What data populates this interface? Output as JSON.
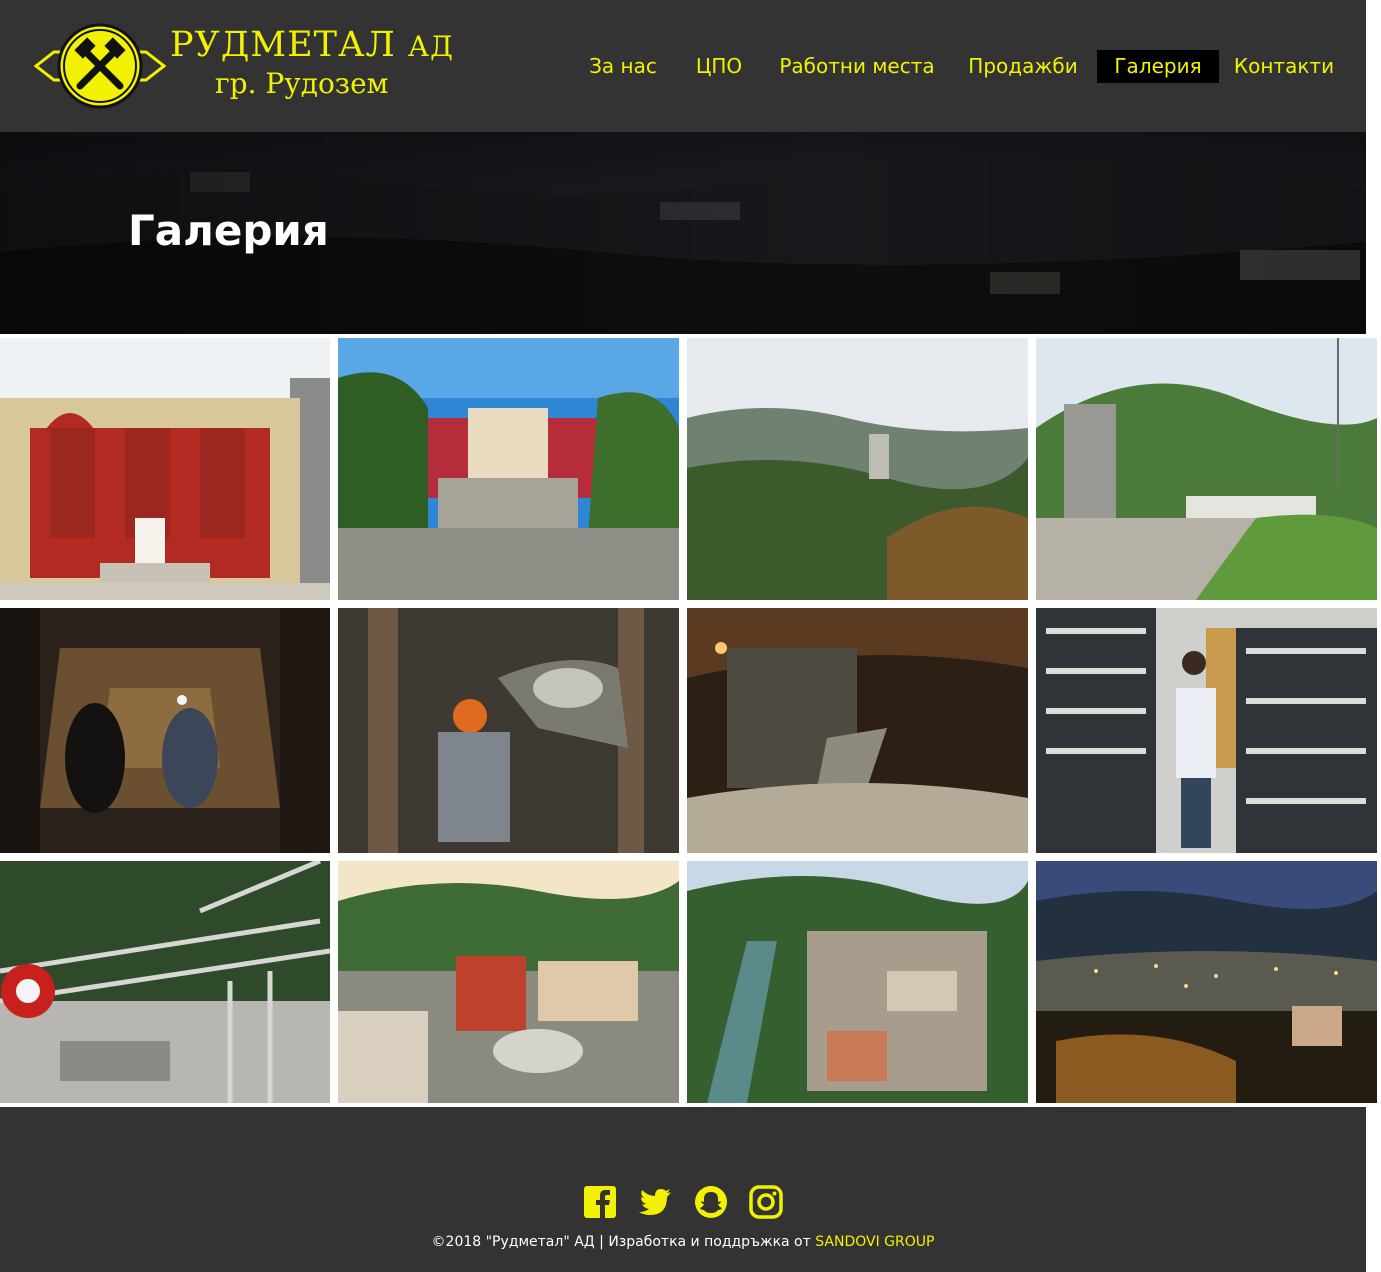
{
  "brand": {
    "name": "РУДМЕТАЛ",
    "suffix": "АД",
    "city": "гр. Рудозем"
  },
  "nav": {
    "items": [
      "За нас",
      "ЦПО",
      "Работни места",
      "Продажби",
      "Галерия",
      "Контакти"
    ],
    "active": "Галерия"
  },
  "hero": {
    "title": "Галерия"
  },
  "gallery": {
    "images": [
      "administration-building-front",
      "administration-building-courtyard",
      "mine-shaft-tower-mountains",
      "mine-shaft-tower-hill",
      "miners-underground",
      "miner-drilling",
      "mine-loader-underground",
      "lamp-room-worker",
      "mine-hoist-machinery",
      "rudozem-aerial-square",
      "rudozem-aerial-river",
      "rudozem-night"
    ]
  },
  "footer": {
    "social": [
      "facebook-icon",
      "twitter-icon",
      "snapchat-icon",
      "instagram-icon"
    ],
    "copyright": "©2018 \"Рудметал\" АД | Изработка и поддръжка от",
    "credit": "SANDOVI GROUP"
  },
  "colors": {
    "accent": "#f2f200",
    "header_bg": "#333333",
    "active_nav_bg": "#000000"
  }
}
